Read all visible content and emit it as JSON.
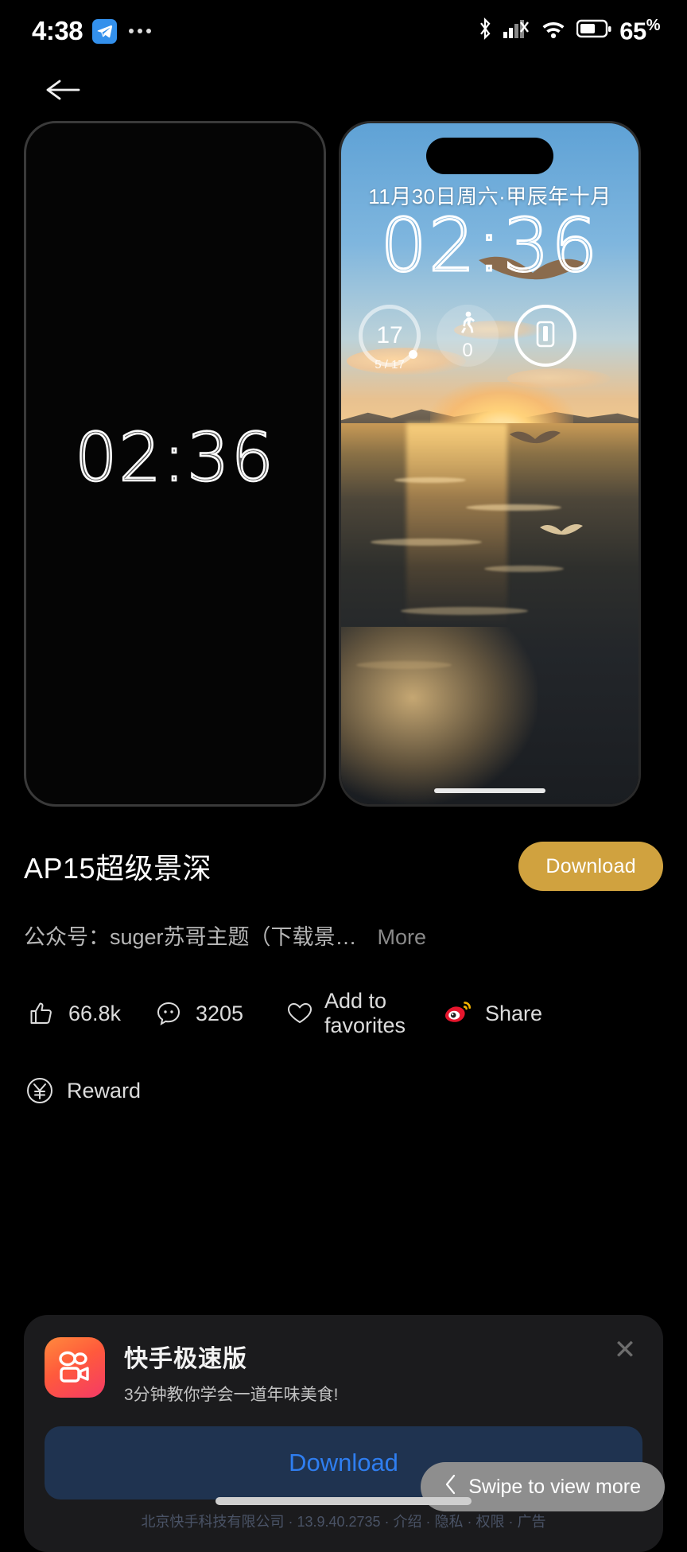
{
  "status_bar": {
    "time": "4:38",
    "app_badge_icon": "telegram-icon",
    "overflow_icon": "more-dots-icon",
    "bluetooth_icon": "bluetooth-icon",
    "signal_icon": "cellular-signal-off-icon",
    "wifi_icon": "wifi-icon",
    "battery_icon": "battery-icon",
    "battery_percent": "65",
    "battery_percent_symbol": "%"
  },
  "nav": {
    "back_icon": "arrow-left-icon",
    "back_label": "Back"
  },
  "previews": {
    "aod": {
      "label": "Always-on display preview",
      "time": "02:36"
    },
    "lockscreen": {
      "label": "Lock screen preview",
      "date": "11月30日周六·甲辰年十月",
      "time": "02:36",
      "widgets": [
        {
          "icon": "calendar-ring-widget",
          "value": "17",
          "sub": "5 / 17"
        },
        {
          "icon": "walking-steps-icon",
          "value": "0",
          "sub": ""
        },
        {
          "icon": "device-phone-icon",
          "value": "",
          "sub": ""
        }
      ]
    }
  },
  "detail": {
    "title": "AP15超级景深",
    "download_label": "Download",
    "description": "公众号：suger苏哥主题（下载景…",
    "more_label": "More"
  },
  "actions": [
    {
      "icon": "thumbs-up-icon",
      "label": "66.8k",
      "name": "like-action"
    },
    {
      "icon": "comment-icon",
      "label": "3205",
      "name": "comment-action"
    },
    {
      "icon": "heart-icon",
      "label": "Add to favorites",
      "name": "favorite-action"
    },
    {
      "icon": "weibo-share-icon",
      "label": "Share",
      "name": "share-action"
    }
  ],
  "reward": {
    "icon": "yuan-circle-icon",
    "label": "Reward"
  },
  "ad": {
    "app_icon": "kuaishou-icon",
    "app_name": "快手极速版",
    "tagline": "3分钟教你学会一道年味美食!",
    "download_label": "Download",
    "close_icon": "close-icon",
    "footer": "北京快手科技有限公司 · 13.9.40.2735 · 介绍 · 隐私 · 权限 · 广告"
  },
  "swipe_hint": {
    "chevron_icon": "chevron-left-icon",
    "label": "Swipe to view more"
  },
  "colors": {
    "background": "#000000",
    "download_accent": "#d0a23f",
    "ad_download_text": "#2f7ef0",
    "ad_card": "#1b1b1d",
    "weibo_red": "#e6162d",
    "swipe_pill": "#8e8e8e"
  }
}
